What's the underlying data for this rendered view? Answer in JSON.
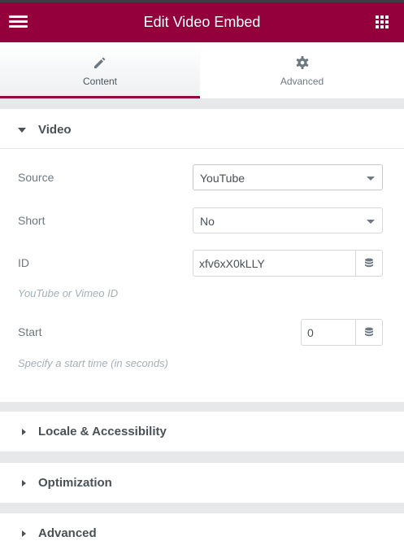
{
  "header": {
    "title": "Edit Video Embed",
    "menu_icon": "hamburger-icon",
    "apps_icon": "grid-icon"
  },
  "tabs": [
    {
      "label": "Content",
      "icon": "pencil-icon",
      "active": true
    },
    {
      "label": "Advanced",
      "icon": "gear-icon",
      "active": false
    }
  ],
  "colors": {
    "brand": "#93003c",
    "label": "#6d7882",
    "heading": "#495157",
    "hint": "#a4afb7"
  },
  "video_section": {
    "title": "Video",
    "expanded": true,
    "fields": {
      "source": {
        "label": "Source",
        "value": "YouTube"
      },
      "short": {
        "label": "Short",
        "value": "No"
      },
      "id": {
        "label": "ID",
        "value": "xfv6xX0kLLY",
        "description": "YouTube or Vimeo ID"
      },
      "start": {
        "label": "Start",
        "value": "0",
        "description": "Specify a start time (in seconds)"
      }
    }
  },
  "collapsed_sections": [
    {
      "title": "Locale & Accessibility"
    },
    {
      "title": "Optimization"
    },
    {
      "title": "Advanced"
    }
  ]
}
